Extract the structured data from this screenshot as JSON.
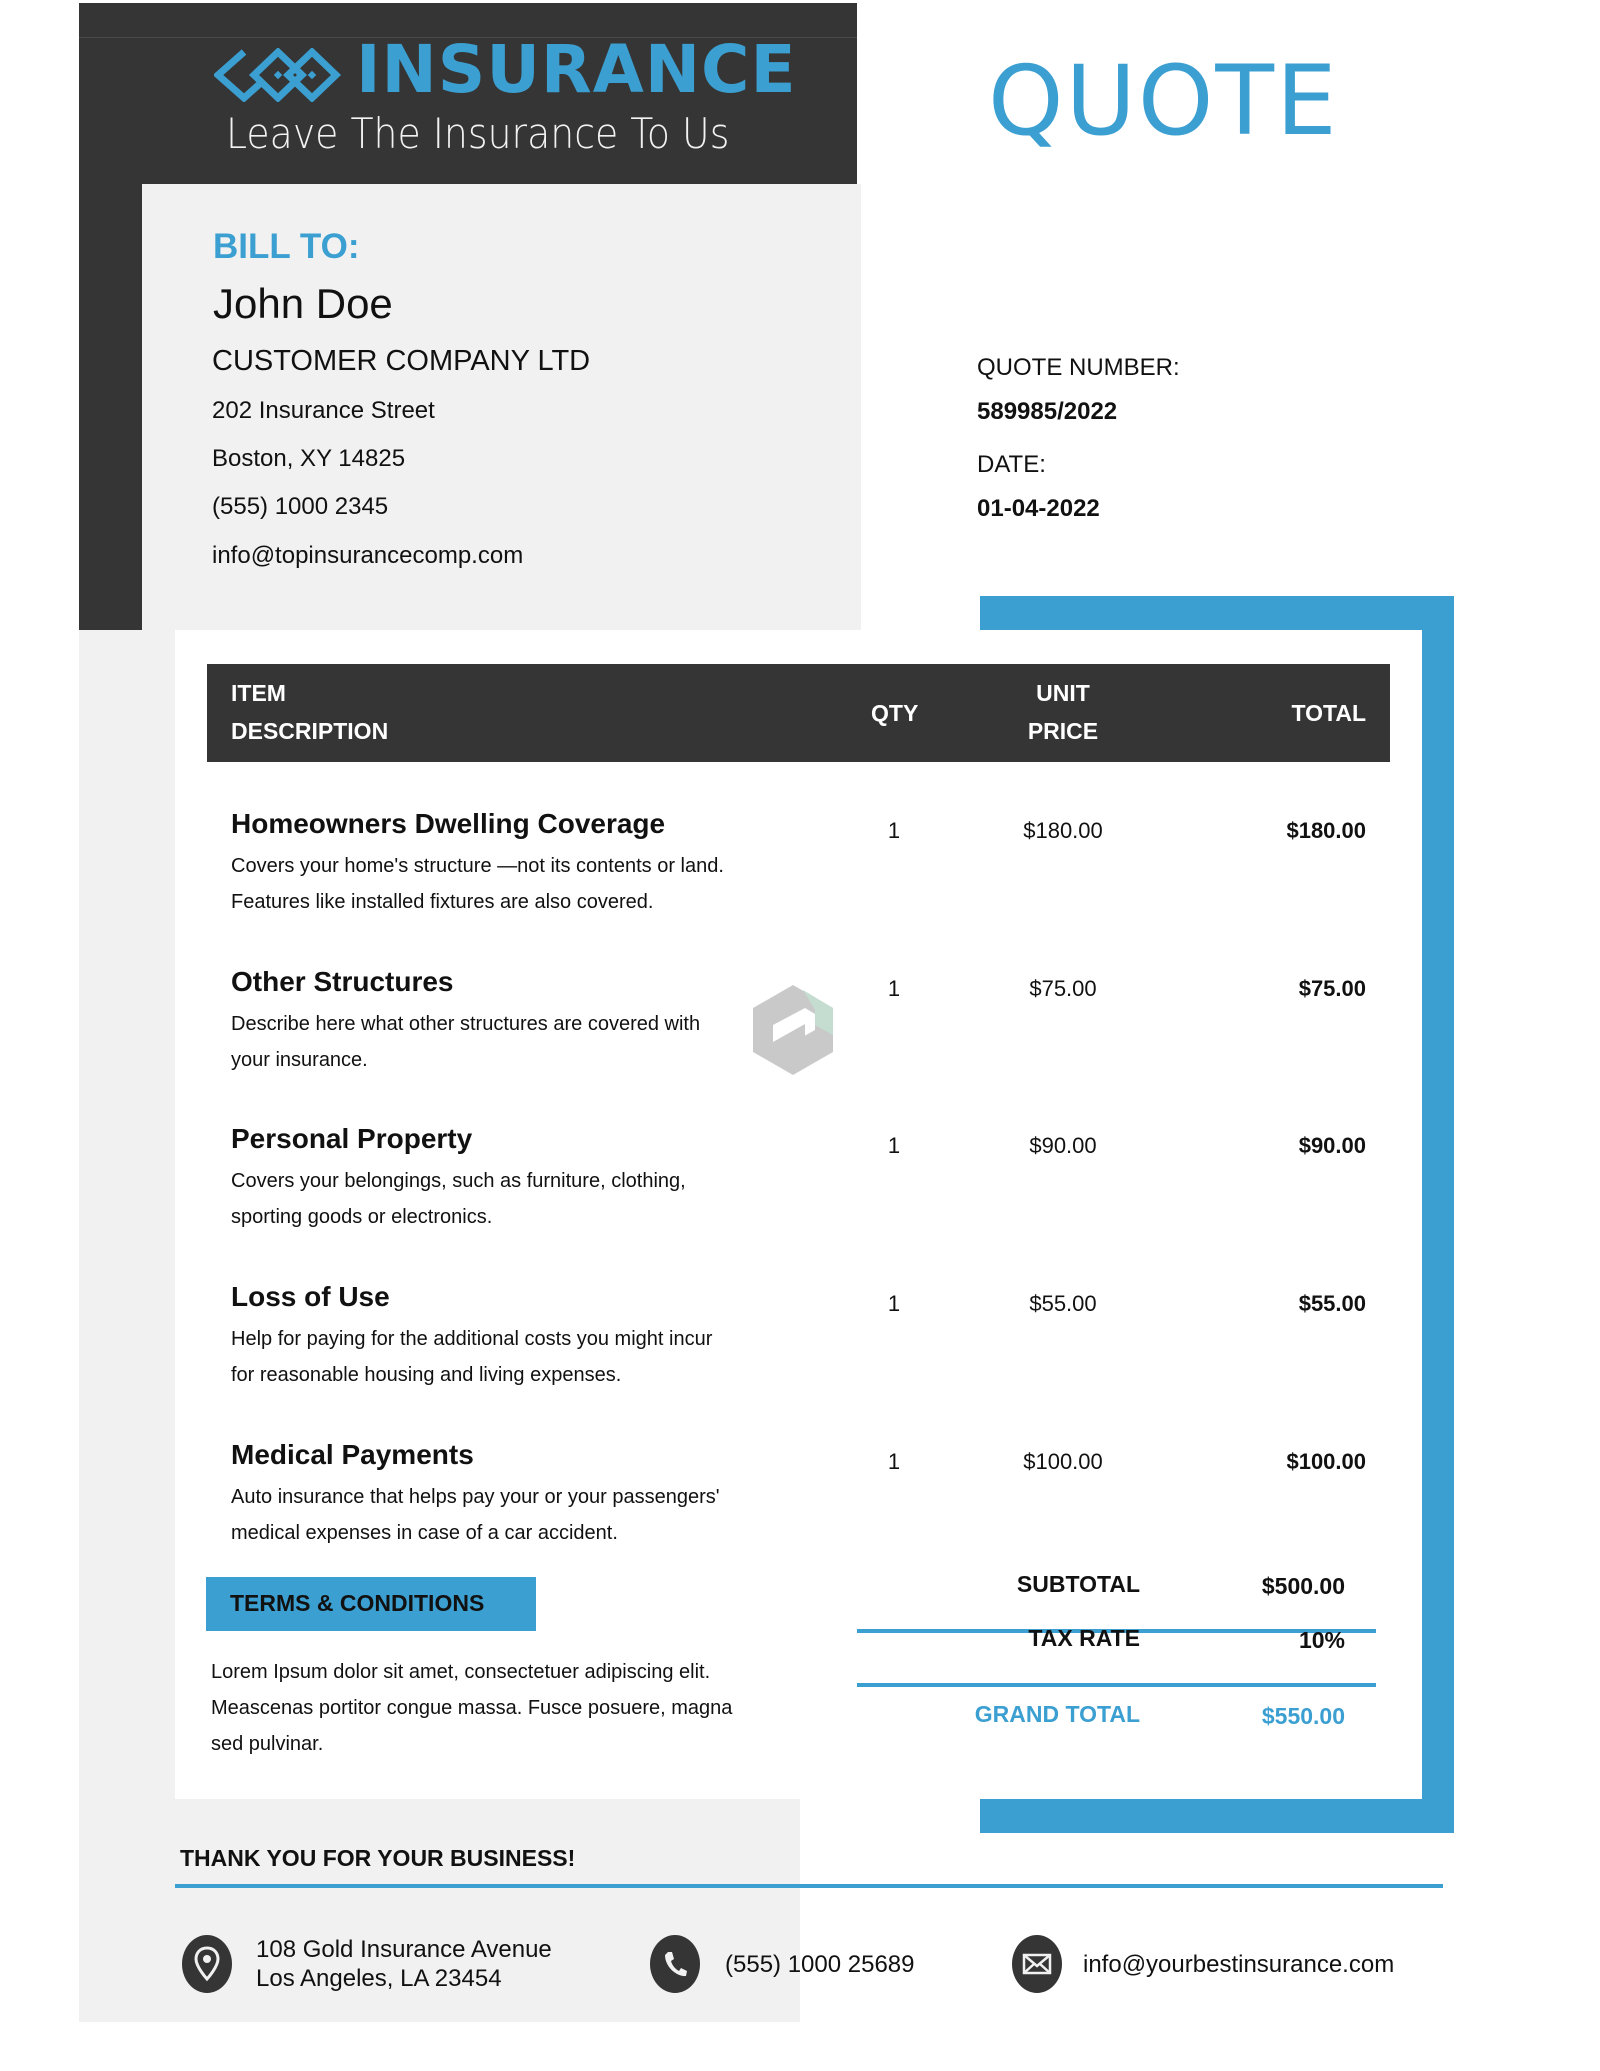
{
  "brand": {
    "name": "INSURANCE",
    "tagline": "Leave The Insurance To Us",
    "logo_icon": "interlocking-diamonds-logo",
    "colors": {
      "accent": "#3b9fd1",
      "dark": "#353535",
      "panel": "#f1f1f1"
    }
  },
  "document": {
    "title": "QUOTE"
  },
  "bill_to": {
    "label": "BILL TO:",
    "name": "John Doe",
    "company": "CUSTOMER COMPANY LTD",
    "street": "202 Insurance Street",
    "city": "Boston, XY 14825",
    "phone": "(555) 1000 2345",
    "email": "info@topinsurancecomp.com"
  },
  "quote_meta": {
    "number_label": "QUOTE NUMBER:",
    "number": "589985/2022",
    "date_label": "DATE:",
    "date": "01-04-2022"
  },
  "table": {
    "headers": {
      "item_line1": "ITEM",
      "item_line2": "DESCRIPTION",
      "qty": "QTY",
      "unit_line1": "UNIT",
      "unit_line2": "PRICE",
      "total": "TOTAL"
    },
    "rows": [
      {
        "title": "Homeowners Dwelling Coverage",
        "desc_line1": "Covers your home's structure —not its contents or land.",
        "desc_line2": "Features like installed fixtures are also covered.",
        "qty": "1",
        "unit_price": "$180.00",
        "total": "$180.00"
      },
      {
        "title": "Other Structures",
        "desc_line1": "Describe here what other structures are covered with",
        "desc_line2": "your insurance.",
        "qty": "1",
        "unit_price": "$75.00",
        "total": "$75.00"
      },
      {
        "title": "Personal Property",
        "desc_line1": "Covers your belongings, such as furniture, clothing,",
        "desc_line2": "sporting goods or electronics.",
        "qty": "1",
        "unit_price": "$90.00",
        "total": "$90.00"
      },
      {
        "title": "Loss of Use",
        "desc_line1": "Help for paying for the additional costs you might incur",
        "desc_line2": "for reasonable housing and living expenses.",
        "qty": "1",
        "unit_price": "$55.00",
        "total": "$55.00"
      },
      {
        "title": "Medical Payments",
        "desc_line1": "Auto insurance that helps pay your or your passengers'",
        "desc_line2": "medical expenses in case of a car accident.",
        "qty": "1",
        "unit_price": "$100.00",
        "total": "$100.00"
      }
    ]
  },
  "terms": {
    "label": "TERMS & CONDITIONS",
    "line1": "Lorem Ipsum dolor sit amet, consectetuer adipiscing elit.",
    "line2": "Meascenas portitor congue massa. Fusce posuere, magna",
    "line3": "sed pulvinar."
  },
  "totals": {
    "subtotal_label": "SUBTOTAL",
    "subtotal": "$500.00",
    "tax_label": "TAX RATE",
    "tax": "10%",
    "grand_label": "GRAND TOTAL",
    "grand": "$550.00"
  },
  "footer": {
    "thanks": "THANK YOU FOR YOUR BUSINESS!",
    "address_line1": "108 Gold Insurance Avenue",
    "address_line2": "Los Angeles, LA 23454",
    "phone": "(555) 1000 25689",
    "email": "info@yourbestinsurance.com",
    "icons": [
      "location-pin-icon",
      "phone-icon",
      "mail-icon"
    ]
  },
  "watermark": {
    "icon": "watermark-logo-icon"
  }
}
